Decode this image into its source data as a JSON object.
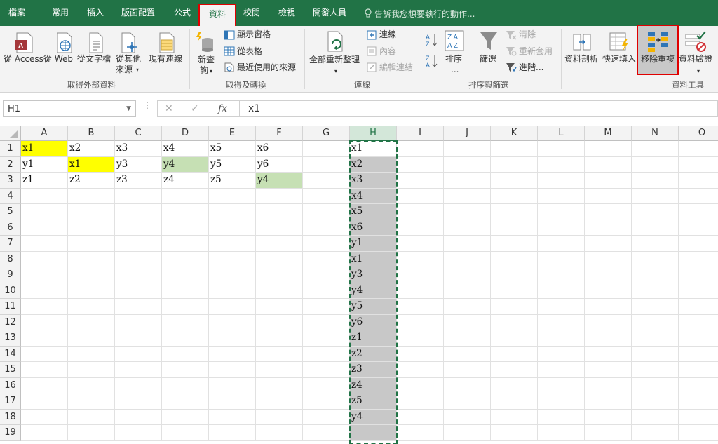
{
  "tabs": [
    {
      "label": "檔案",
      "name": "tab-file"
    },
    {
      "label": "常用",
      "name": "tab-home"
    },
    {
      "label": "插入",
      "name": "tab-insert"
    },
    {
      "label": "版面配置",
      "name": "tab-page-layout"
    },
    {
      "label": "公式",
      "name": "tab-formulas"
    },
    {
      "label": "資料",
      "name": "tab-data",
      "active": true
    },
    {
      "label": "校閱",
      "name": "tab-review"
    },
    {
      "label": "檢視",
      "name": "tab-view"
    },
    {
      "label": "開發人員",
      "name": "tab-developer"
    }
  ],
  "tell_me": "告訴我您想要執行的動作...",
  "ribbon": {
    "get_external": {
      "access": "從 Access",
      "web": "從 Web",
      "text": "從文字檔",
      "other_1": "從其他",
      "other_2": "來源",
      "existing": "現有連線",
      "group": "取得外部資料"
    },
    "get_transform": {
      "new_query_1": "新查",
      "new_query_2": "詢",
      "show_queries": "顯示窗格",
      "from_table": "從表格",
      "recent_sources": "最近使用的來源",
      "group": "取得及轉換"
    },
    "connections": {
      "refresh_all": "全部重新整理",
      "connections": "連線",
      "properties": "內容",
      "edit_links": "編輯連結",
      "group": "連線"
    },
    "sort_filter": {
      "sort": "排序",
      "sort_more": "...",
      "filter": "篩選",
      "clear": "清除",
      "reapply": "重新套用",
      "advanced": "進階...",
      "group": "排序與篩選"
    },
    "data_tools": {
      "text_to_columns": "資料剖析",
      "flash_fill": "快速填入",
      "remove_duplicates": "移除重複",
      "data_validation": "資料驗證",
      "group": "資料工具"
    }
  },
  "formula_bar": {
    "name_box": "H1",
    "formula": "x1"
  },
  "columns": [
    "A",
    "B",
    "C",
    "D",
    "E",
    "F",
    "G",
    "H",
    "I",
    "J",
    "K",
    "L",
    "M",
    "N",
    "O"
  ],
  "selected_column": "H",
  "rows": [
    "1",
    "2",
    "3",
    "4",
    "5",
    "6",
    "7",
    "8",
    "9",
    "10",
    "11",
    "12",
    "13",
    "14",
    "15",
    "16",
    "17",
    "18",
    "19"
  ],
  "cells": {
    "A1": "x1",
    "B1": "x2",
    "C1": "x3",
    "D1": "x4",
    "E1": "x5",
    "F1": "x6",
    "A2": "y1",
    "B2": "x1",
    "C2": "y3",
    "D2": "y4",
    "E2": "y5",
    "F2": "y6",
    "A3": "z1",
    "B3": "z2",
    "C3": "z3",
    "D3": "z4",
    "E3": "z5",
    "F3": "y4",
    "H1": "x1",
    "H2": "x2",
    "H3": "x3",
    "H4": "x4",
    "H5": "x5",
    "H6": "x6",
    "H7": "y1",
    "H8": "x1",
    "H9": "y3",
    "H10": "y4",
    "H11": "y5",
    "H12": "y6",
    "H13": "z1",
    "H14": "z2",
    "H15": "z3",
    "H16": "z4",
    "H17": "z5",
    "H18": "y4"
  },
  "highlights": {
    "yellow": [
      "A1",
      "B2"
    ],
    "green": [
      "D2",
      "F3"
    ]
  },
  "colors": {
    "excel_green": "#217346",
    "highlight_yellow": "#ffff00",
    "highlight_green": "#c6e0b4",
    "selection_gray": "#c8c8c8",
    "callout_red": "#e00000"
  }
}
